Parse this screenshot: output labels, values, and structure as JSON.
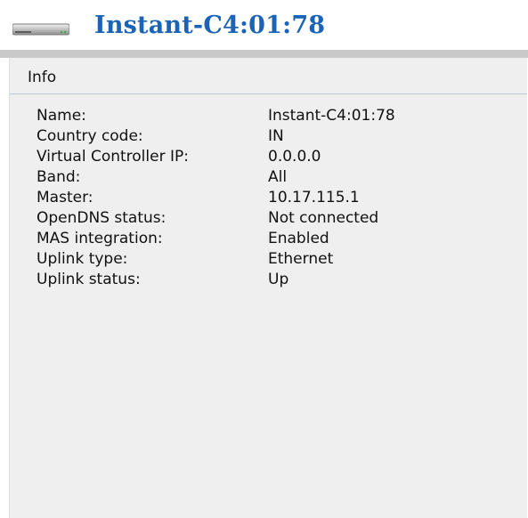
{
  "header": {
    "icon": "device-icon",
    "title": "Instant-C4:01:78"
  },
  "panel": {
    "title": "Info",
    "rows": [
      {
        "label": "Name:",
        "value": "Instant-C4:01:78"
      },
      {
        "label": "Country code:",
        "value": "IN"
      },
      {
        "label": "Virtual Controller IP:",
        "value": "0.0.0.0"
      },
      {
        "label": "Band:",
        "value": "All"
      },
      {
        "label": "Master:",
        "value": "10.17.115.1"
      },
      {
        "label": "OpenDNS status:",
        "value": "Not connected"
      },
      {
        "label": "MAS integration:",
        "value": "Enabled"
      },
      {
        "label": "Uplink type:",
        "value": "Ethernet"
      },
      {
        "label": "Uplink status:",
        "value": "Up"
      }
    ]
  },
  "colors": {
    "title": "#1a63b7",
    "panel_background": "#efefef",
    "divider": "#c9c9c9"
  }
}
